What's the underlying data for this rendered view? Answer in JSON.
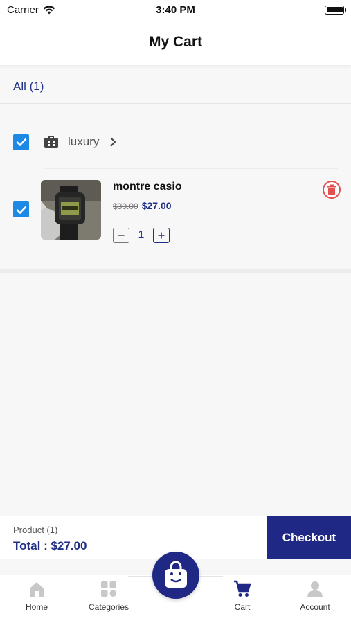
{
  "status_bar": {
    "carrier": "Carrier",
    "time": "3:40 PM"
  },
  "header": {
    "title": "My Cart"
  },
  "filter": {
    "all_label": "All (1)"
  },
  "store": {
    "name": "luxury"
  },
  "item": {
    "name": "montre casio",
    "old_price": "$30.00",
    "price": "$27.00",
    "quantity": "1"
  },
  "summary": {
    "product_count": "Product (1)",
    "total": "Total : $27.00",
    "checkout_label": "Checkout"
  },
  "tabs": [
    {
      "label": "Home",
      "icon": "home-icon"
    },
    {
      "label": "Categories",
      "icon": "categories-icon"
    },
    {
      "label": "Cart",
      "icon": "cart-icon"
    },
    {
      "label": "Account",
      "icon": "account-icon"
    }
  ],
  "colors": {
    "brand": "#1f2884",
    "checkbox": "#1e88e5",
    "delete": "#e45050",
    "inactive_icon": "#c8c8c8"
  }
}
